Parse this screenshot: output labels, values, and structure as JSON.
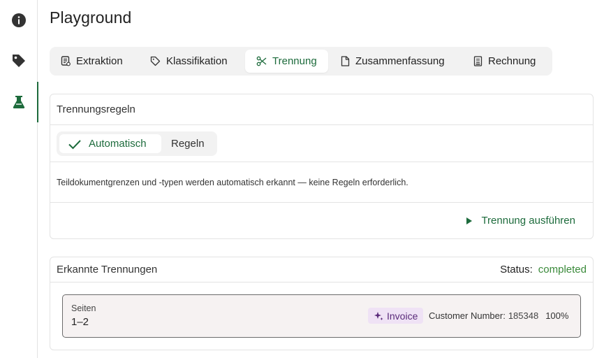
{
  "rail": {
    "items": [
      {
        "icon": "info-icon"
      },
      {
        "icon": "tag-icon"
      },
      {
        "icon": "flask-icon",
        "active": true
      }
    ]
  },
  "page": {
    "title": "Playground"
  },
  "tabs": [
    {
      "label": "Extraktion",
      "icon": "receipt-icon"
    },
    {
      "label": "Klassifikation",
      "icon": "tag-outline-icon"
    },
    {
      "label": "Trennung",
      "icon": "scissors-icon",
      "active": true
    },
    {
      "label": "Zusammenfassung",
      "icon": "document-icon"
    },
    {
      "label": "Rechnung",
      "icon": "invoice-icon"
    }
  ],
  "rules_card": {
    "title": "Trennungsregeln",
    "mode_options": [
      {
        "label": "Automatisch",
        "selected": true
      },
      {
        "label": "Regeln",
        "selected": false
      }
    ],
    "description": "Teildokumentgrenzen und -typen werden automatisch erkannt — keine Regeln erforderlich.",
    "run_label": "Trennung ausführen"
  },
  "results_card": {
    "title": "Erkannte Trennungen",
    "status_label": "Status:",
    "status_value": "completed",
    "segments": [
      {
        "pages_label": "Seiten",
        "pages_value": "1–2",
        "type_label": "Invoice",
        "field_label": "Customer Number:",
        "field_value": "185348",
        "confidence": "100%"
      }
    ]
  },
  "colors": {
    "accent": "#1d6b3c",
    "status_ok": "#3a8a3a",
    "badge_bg": "#efe2f5",
    "badge_text": "#5a2a7a"
  }
}
